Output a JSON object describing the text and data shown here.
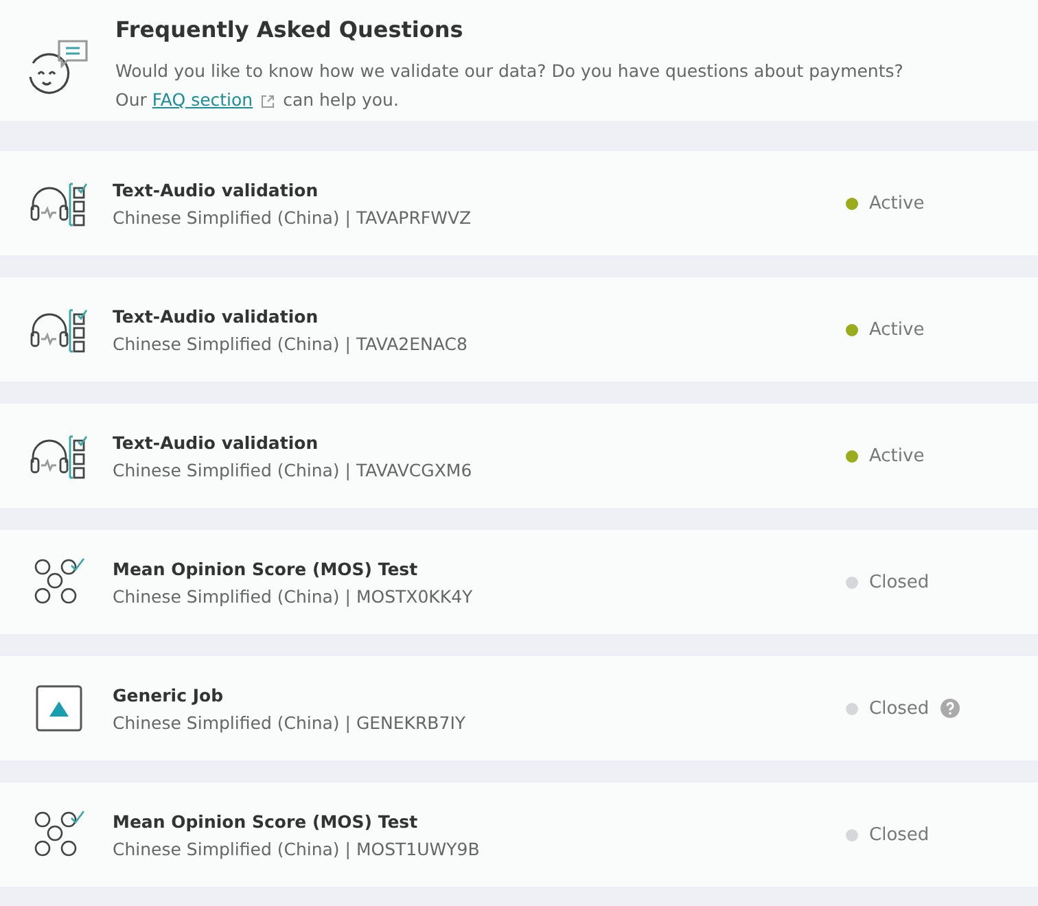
{
  "faq": {
    "title": "Frequently Asked Questions",
    "line1": "Would you like to know how we validate our data? Do you have questions about payments?",
    "line2_before": "Our",
    "link": "FAQ section",
    "line2_after": "can help you."
  },
  "jobs": [
    {
      "kind": "audio",
      "title": "Text-Audio validation",
      "subtitle": "Chinese Simplified (China) | TAVAPRFWVZ",
      "status": "Active",
      "color": "#9aab1c",
      "help": false
    },
    {
      "kind": "audio",
      "title": "Text-Audio validation",
      "subtitle": "Chinese Simplified (China) | TAVA2ENAC8",
      "status": "Active",
      "color": "#9aab1c",
      "help": false
    },
    {
      "kind": "audio",
      "title": "Text-Audio validation",
      "subtitle": "Chinese Simplified (China) | TAVAVCGXM6",
      "status": "Active",
      "color": "#9aab1c",
      "help": false
    },
    {
      "kind": "mos",
      "title": "Mean Opinion Score (MOS) Test",
      "subtitle": "Chinese Simplified (China) | MOSTX0KK4Y",
      "status": "Closed",
      "color": "#d6d7db",
      "help": false
    },
    {
      "kind": "generic",
      "title": "Generic Job",
      "subtitle": "Chinese Simplified (China) | GENEKRB7IY",
      "status": "Closed",
      "color": "#d6d7db",
      "help": true
    },
    {
      "kind": "mos",
      "title": "Mean Opinion Score (MOS) Test",
      "subtitle": "Chinese Simplified (China) | MOST1UWY9B",
      "status": "Closed",
      "color": "#d6d7db",
      "help": false
    }
  ]
}
